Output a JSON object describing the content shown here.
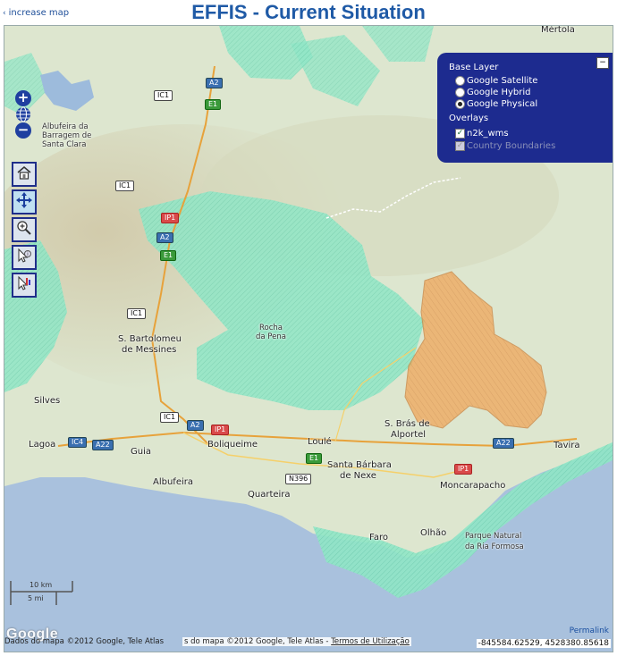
{
  "header": {
    "increase_link": "increase map",
    "title": "EFFIS - Current Situation"
  },
  "map": {
    "places": {
      "mertola": "Mértola",
      "albufeira_barragem_1": "Albufeira da",
      "albufeira_barragem_2": "Barragem de",
      "albufeira_barragem_3": "Santa Clara",
      "rocha_pena_1": "Rocha",
      "rocha_pena_2": "da Pena",
      "s_bartolomeu_1": "S. Bartolomeu",
      "s_bartolomeu_2": "de Messines",
      "silves": "Silves",
      "lagoa": "Lagoa",
      "guia": "Guia",
      "boliqueime": "Boliqueime",
      "loule": "Loulé",
      "s_bras_1": "S. Brás de",
      "s_bras_2": "Alportel",
      "tavira": "Tavira",
      "santa_barbara_1": "Santa Bárbara",
      "santa_barbara_2": "de Nexe",
      "moncarapacho": "Moncarapacho",
      "albufeira": "Albufeira",
      "quarteira": "Quarteira",
      "faro": "Faro",
      "olhao": "Olhão",
      "ria_formosa_1": "Parque Natural",
      "ria_formosa_2": "da Ria Formosa"
    },
    "road_shields": {
      "a2_top": "A2",
      "ic1_top": "IC1",
      "e1_top": "E1",
      "ic1_mid": "IC1",
      "ip1_mid": "IP1",
      "a2_mid": "A2",
      "e1_mid": "E1",
      "ic1_low": "IC1",
      "ic1_south": "IC1",
      "a2_south": "A2",
      "ip1_south": "IP1",
      "ic4": "IC4",
      "a22_west": "A22",
      "e1_south": "E1",
      "n396": "N396",
      "ip1_east": "IP1",
      "a22_east": "A22"
    },
    "colors": {
      "terrain": "#dde6cf",
      "sea": "#a9c1dd",
      "natura2000": "#8fe6c6",
      "burnt_area": "#f0a75a"
    }
  },
  "controls": {
    "zoom_in": "+",
    "zoom_out": "−",
    "tools": [
      "home-icon",
      "pan-icon",
      "zoom-box-icon",
      "info-icon",
      "legend-icon"
    ]
  },
  "layer_switcher": {
    "minimize": "−",
    "base_layer_title": "Base Layer",
    "base_layers": [
      {
        "label": "Google Satellite",
        "selected": false
      },
      {
        "label": "Google Hybrid",
        "selected": false
      },
      {
        "label": "Google Physical",
        "selected": true
      }
    ],
    "overlays_title": "Overlays",
    "overlays": [
      {
        "label": "n2k_wms",
        "checked": true,
        "disabled": false
      },
      {
        "label": "Country Boundaries",
        "checked": true,
        "disabled": true
      }
    ]
  },
  "scale": {
    "km": "10 km",
    "mi": "5 mi"
  },
  "footer": {
    "google_logo": "Google",
    "attribution": "Dados do mapa ©2012 Google, Tele Atlas",
    "attribution_overlay": "s do mapa ©2012 Google, Tele Atlas -",
    "terms": "Termos de Utilização",
    "permalink": "Permalink",
    "coordinates": "-845584.62529, 4528380.85618"
  }
}
